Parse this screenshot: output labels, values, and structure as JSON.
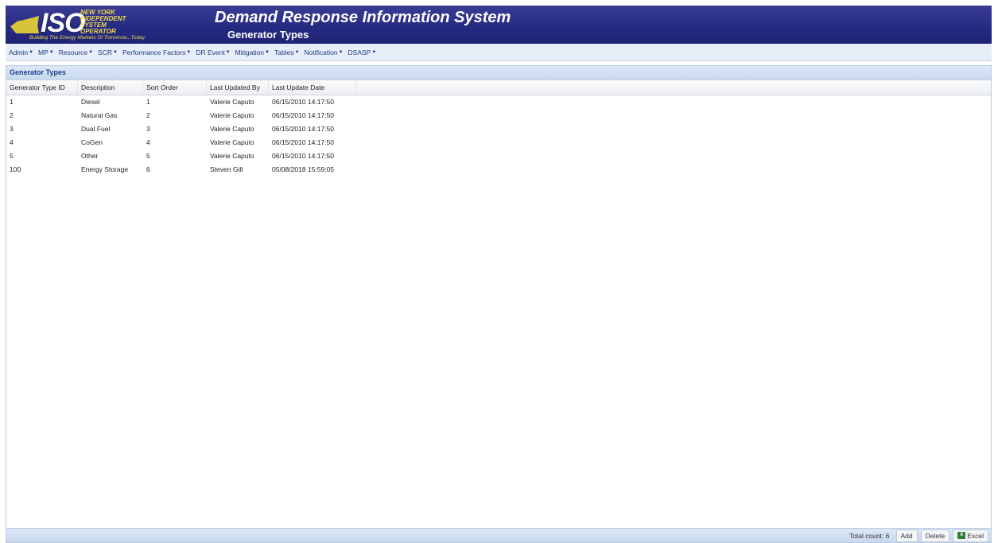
{
  "header": {
    "logo": {
      "iso_text": "ISO",
      "org_name": "NEW YORK INDEPENDENT SYSTEM OPERATOR",
      "tagline": "Building The Energy Markets Of Tomorrow...Today"
    },
    "app_title": "Demand Response Information System",
    "page_subtitle": "Generator Types",
    "colors": {
      "banner": "#262b82",
      "logo_accent": "#f0d94a"
    }
  },
  "menu": [
    {
      "label": "Admin"
    },
    {
      "label": "MP"
    },
    {
      "label": "Resource"
    },
    {
      "label": "SCR"
    },
    {
      "label": "Performance Factors"
    },
    {
      "label": "DR Event"
    },
    {
      "label": "Mitigation"
    },
    {
      "label": "Tables"
    },
    {
      "label": "Notification"
    },
    {
      "label": "DSASP"
    }
  ],
  "grid": {
    "title": "Generator Types",
    "columns": [
      "Generator Type ID",
      "Description",
      "Sort Order",
      "Last Updated By",
      "Last Update Date"
    ],
    "rows": [
      [
        "1",
        "Diesel",
        "1",
        "Valerie Caputo",
        "06/15/2010 14:17:50"
      ],
      [
        "2",
        "Natural Gas",
        "2",
        "Valerie Caputo",
        "06/15/2010 14:17:50"
      ],
      [
        "3",
        "Dual Fuel",
        "3",
        "Valerie Caputo",
        "06/15/2010 14:17:50"
      ],
      [
        "4",
        "CoGen",
        "4",
        "Valerie Caputo",
        "06/15/2010 14:17:50"
      ],
      [
        "5",
        "Other",
        "5",
        "Valerie Caputo",
        "06/15/2010 14:17:50"
      ],
      [
        "100",
        "Energy Storage",
        "6",
        "Steven Gill",
        "05/08/2018 15:59:05"
      ]
    ]
  },
  "footer": {
    "total_count": "Total count: 6",
    "add_label": "Add",
    "delete_label": "Delete",
    "excel_label": "Excel",
    "excel_icon": "excel-icon"
  }
}
